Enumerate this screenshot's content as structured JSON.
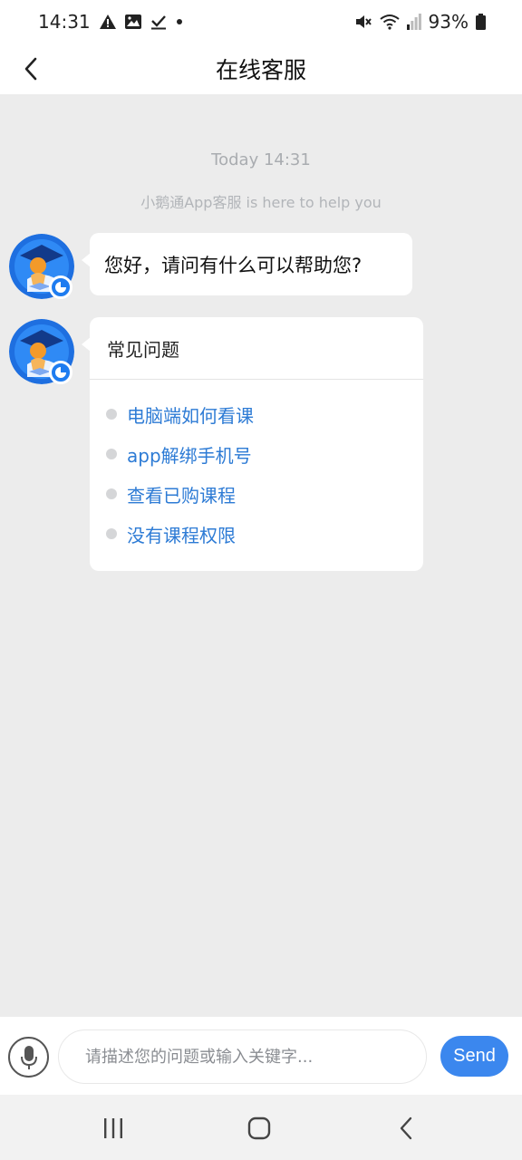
{
  "status_bar": {
    "time": "14:31",
    "battery": "93%",
    "icons": [
      "warning-icon",
      "image-icon",
      "check-icon",
      "dot-icon",
      "mute-icon",
      "wifi-icon",
      "signal-icon",
      "battery-icon"
    ]
  },
  "header": {
    "title": "在线客服",
    "back_icon": "chevron-left-icon"
  },
  "chat": {
    "timestamp": "Today 14:31",
    "system_message": "小鹅通App客服 is here to help you",
    "messages": [
      {
        "type": "text",
        "text": "您好，请问有什么可以帮助您?"
      },
      {
        "type": "faq",
        "title": "常见问题",
        "items": [
          "电脑端如何看课",
          "app解绑手机号",
          "查看已购课程",
          "没有课程权限"
        ]
      }
    ]
  },
  "input": {
    "placeholder": "请描述您的问题或输入关键字...",
    "value": "",
    "send_label": "Send",
    "mic_icon": "microphone-icon"
  },
  "nav": {
    "buttons": [
      "recent-apps-icon",
      "home-icon",
      "back-icon"
    ]
  },
  "colors": {
    "accent": "#3b87ee",
    "link": "#2d7bd5",
    "background": "#ececec"
  }
}
